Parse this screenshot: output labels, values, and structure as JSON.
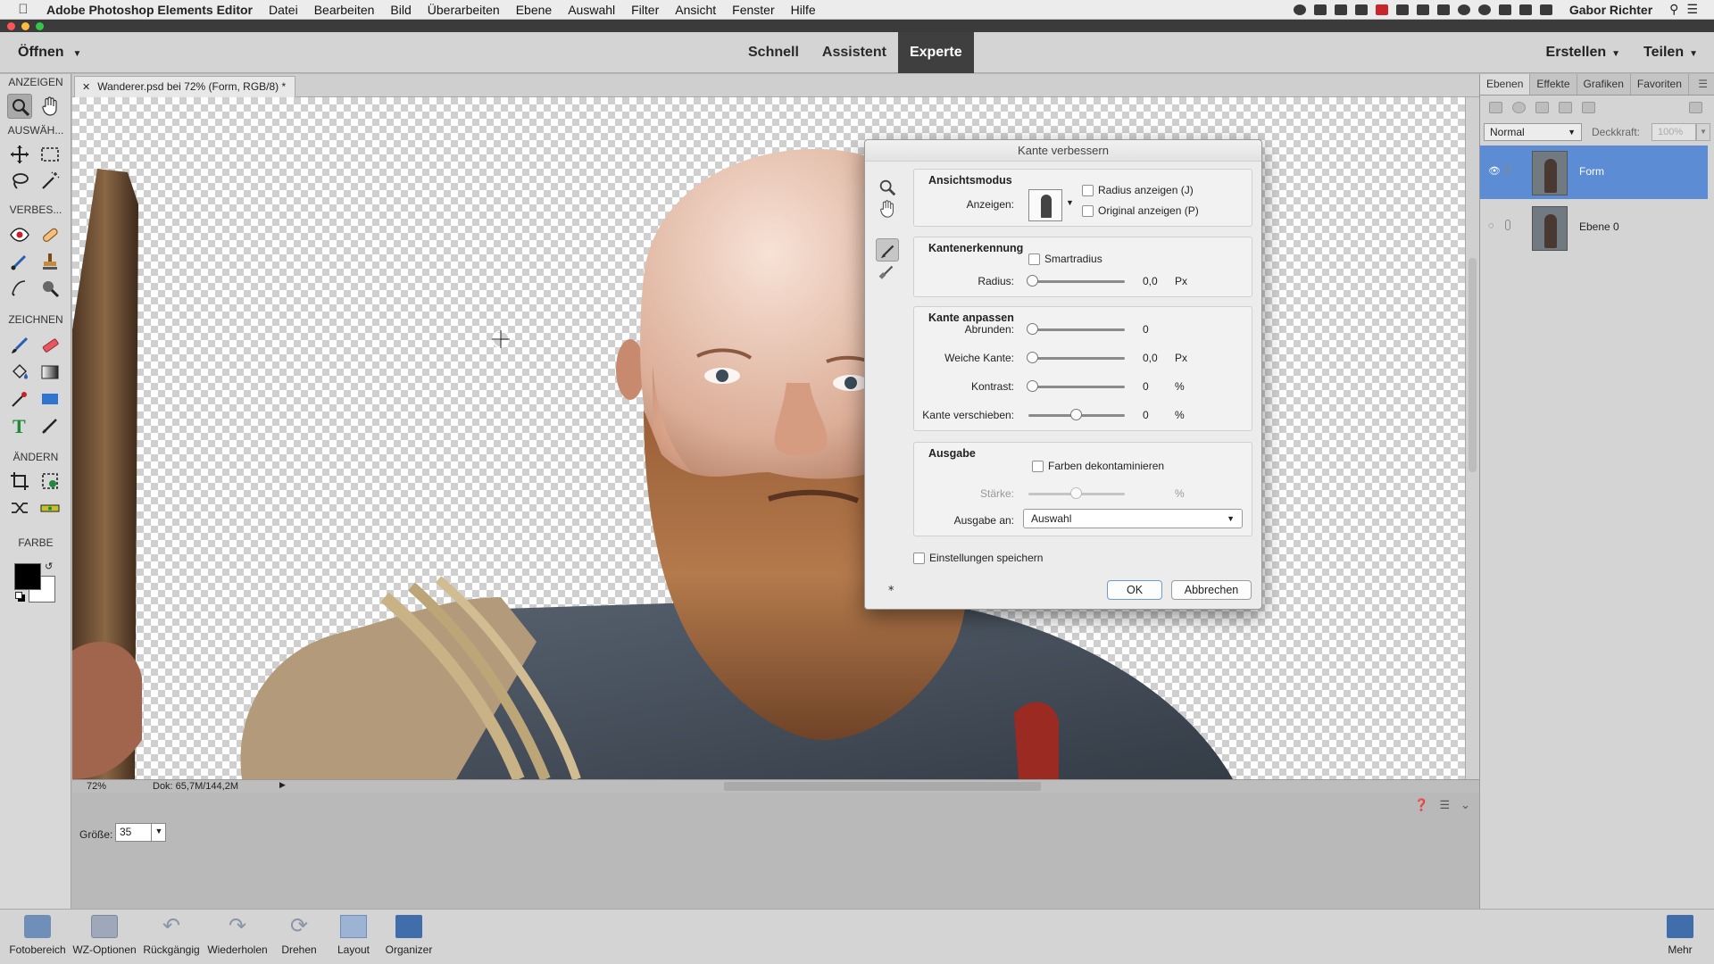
{
  "menubar": {
    "app_name": "Adobe Photoshop Elements Editor",
    "menus": [
      "Datei",
      "Bearbeiten",
      "Bild",
      "Überarbeiten",
      "Ebene",
      "Auswahl",
      "Filter",
      "Ansicht",
      "Fenster",
      "Hilfe"
    ],
    "user": "Gabor Richter"
  },
  "header": {
    "open_label": "Öffnen",
    "modes": [
      "Schnell",
      "Assistent",
      "Experte"
    ],
    "active_mode": "Experte",
    "create_label": "Erstellen",
    "share_label": "Teilen"
  },
  "toolbox": {
    "sections": [
      "ANZEIGEN",
      "AUSWÄH...",
      "VERBES...",
      "ZEICHNEN",
      "ÄNDERN",
      "FARBE"
    ]
  },
  "document": {
    "tab_title": "Wanderer.psd bei 72% (Form, RGB/8) *",
    "zoom": "72%",
    "doc_size": "Dok: 65,7M/144,2M"
  },
  "tool_options": {
    "size_label": "Größe:",
    "size_value": "35"
  },
  "layers_panel": {
    "tabs": [
      "Ebenen",
      "Effekte",
      "Grafiken",
      "Favoriten"
    ],
    "blend_mode": "Normal",
    "opacity_label": "Deckkraft:",
    "opacity_value": "100%",
    "layers": [
      {
        "name": "Form",
        "selected": true
      },
      {
        "name": "Ebene 0",
        "selected": false
      }
    ]
  },
  "dialog": {
    "title": "Kante verbessern",
    "view_mode": {
      "title": "Ansichtsmodus",
      "show_label": "Anzeigen:",
      "show_radius_label": "Radius anzeigen (J)",
      "show_original_label": "Original anzeigen (P)"
    },
    "edge_detection": {
      "title": "Kantenerkennung",
      "smart_radius_label": "Smartradius",
      "radius_label": "Radius:",
      "radius_value": "0,0",
      "radius_unit": "Px"
    },
    "adjust_edge": {
      "title": "Kante anpassen",
      "smooth_label": "Abrunden:",
      "smooth_value": "0",
      "feather_label": "Weiche Kante:",
      "feather_value": "0,0",
      "feather_unit": "Px",
      "contrast_label": "Kontrast:",
      "contrast_value": "0",
      "contrast_unit": "%",
      "shift_label": "Kante verschieben:",
      "shift_value": "0",
      "shift_unit": "%"
    },
    "output": {
      "title": "Ausgabe",
      "decontaminate_label": "Farben dekontaminieren",
      "amount_label": "Stärke:",
      "amount_unit": "%",
      "output_to_label": "Ausgabe an:",
      "output_to_value": "Auswahl"
    },
    "remember_label": "Einstellungen speichern",
    "ok_label": "OK",
    "cancel_label": "Abbrechen"
  },
  "taskbar": {
    "items": [
      "Fotobereich",
      "WZ-Optionen",
      "Rückgängig",
      "Wiederholen",
      "Drehen",
      "Layout",
      "Organizer"
    ],
    "more_label": "Mehr"
  }
}
